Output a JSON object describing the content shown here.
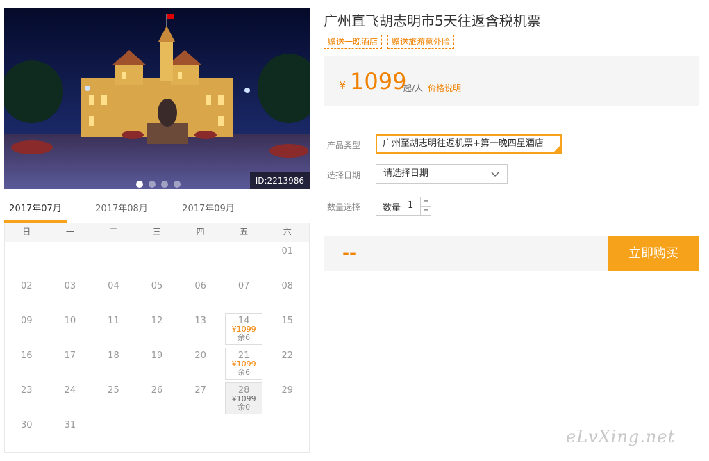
{
  "photo": {
    "id_label": "ID:2213986",
    "dots": 4,
    "active_dot": 0
  },
  "months": [
    {
      "label": "2017年07月",
      "active": true
    },
    {
      "label": "2017年08月",
      "active": false
    },
    {
      "label": "2017年09月",
      "active": false
    }
  ],
  "calendar": {
    "weekdays": [
      "日",
      "一",
      "二",
      "三",
      "四",
      "五",
      "六"
    ],
    "rows": [
      [
        null,
        null,
        null,
        null,
        null,
        null,
        {
          "day": "01"
        }
      ],
      [
        {
          "day": "02"
        },
        {
          "day": "03"
        },
        {
          "day": "04"
        },
        {
          "day": "05"
        },
        {
          "day": "06"
        },
        {
          "day": "07"
        },
        {
          "day": "08"
        }
      ],
      [
        {
          "day": "09"
        },
        {
          "day": "10"
        },
        {
          "day": "11"
        },
        {
          "day": "12"
        },
        {
          "day": "13"
        },
        {
          "day": "14",
          "price": "¥1099",
          "stock": "余6"
        },
        {
          "day": "15"
        }
      ],
      [
        {
          "day": "16"
        },
        {
          "day": "17"
        },
        {
          "day": "18"
        },
        {
          "day": "19"
        },
        {
          "day": "20"
        },
        {
          "day": "21",
          "price": "¥1099",
          "stock": "余6"
        },
        {
          "day": "22"
        }
      ],
      [
        {
          "day": "23"
        },
        {
          "day": "24"
        },
        {
          "day": "25"
        },
        {
          "day": "26"
        },
        {
          "day": "27"
        },
        {
          "day": "28",
          "price": "¥1099",
          "stock": "余0",
          "sold_out": true
        },
        {
          "day": "29"
        }
      ],
      [
        {
          "day": "30"
        },
        {
          "day": "31"
        },
        null,
        null,
        null,
        null,
        null
      ]
    ]
  },
  "product": {
    "title": "广州直飞胡志明市5天往返含税机票",
    "tags": [
      "赠送一晚酒店",
      "赠送旅游意外险"
    ],
    "price_symbol": "¥",
    "price": "1099",
    "price_unit": "起/人",
    "price_note": "价格说明"
  },
  "form": {
    "type_label": "产品类型",
    "type_value": "广州至胡志明往返机票+第一晚四星酒店",
    "date_label": "选择日期",
    "date_placeholder": "请选择日期",
    "qty_label": "数量选择",
    "qty_inner_label": "数量",
    "qty_value": "1",
    "qty_plus": "+",
    "qty_minus": "−"
  },
  "buy": {
    "total": "--",
    "button": "立即购买"
  },
  "colors": {
    "accent": "#f7a21b",
    "price": "#f08200"
  },
  "watermark": "eLvXing.net"
}
